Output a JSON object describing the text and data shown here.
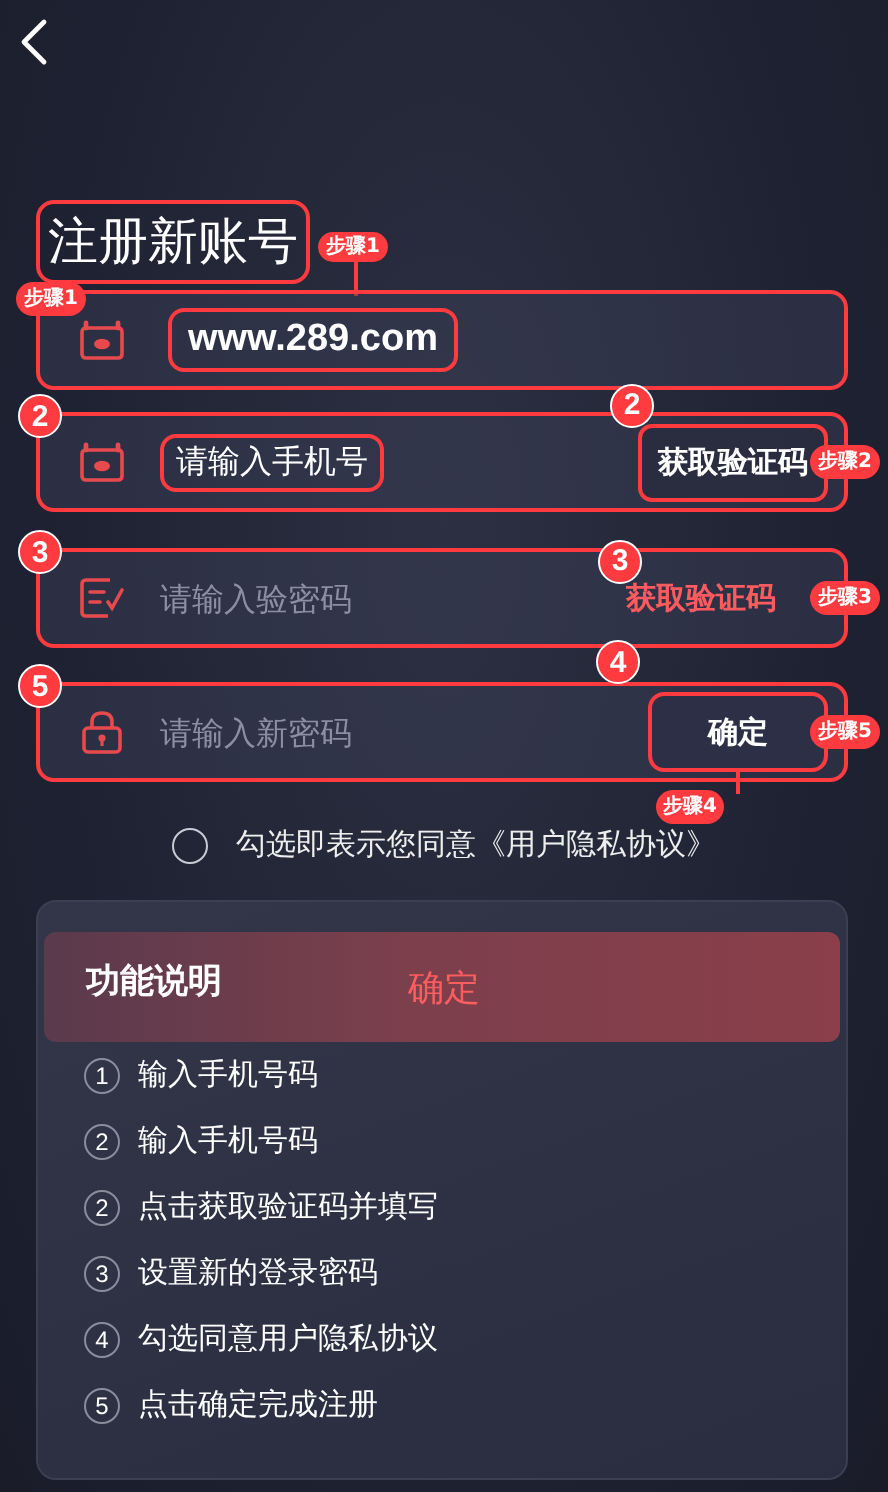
{
  "title": "注册新账号",
  "title_tag": "步骤1",
  "fields": [
    {
      "kind": "site",
      "value": "www.289.com",
      "corner_badge": {
        "kind": "pill",
        "text": "步骤1"
      }
    },
    {
      "kind": "phone",
      "value": "请输入手机号",
      "corner_badge": {
        "kind": "number",
        "text": "2"
      },
      "action": {
        "kind": "outlined",
        "text": "获取验证码",
        "badge": "2"
      },
      "side_badge": "步骤2"
    },
    {
      "kind": "code",
      "placeholder": "请输入验密码",
      "corner_badge": {
        "kind": "number",
        "text": "3"
      },
      "action": {
        "kind": "text",
        "text": "获取验证码",
        "badge": "3"
      },
      "side_badge": "步骤3"
    },
    {
      "kind": "password",
      "placeholder": "请输入新密码",
      "corner_badge": {
        "kind": "number",
        "text": "5"
      },
      "action": {
        "kind": "button",
        "text": "确定",
        "badge": "4",
        "below_badge": "步骤4"
      },
      "side_badge": "步骤5"
    }
  ],
  "agreement": {
    "checked": false,
    "text": "勾选即表示您同意《用户隐私协议》"
  },
  "guide": {
    "title": "功能说明",
    "overlay": "确定",
    "steps": [
      {
        "number": "1",
        "text": "输入手机号码"
      },
      {
        "number": "2",
        "text": "输入手机号码"
      },
      {
        "number": "2",
        "text": "点击获取验证码并填写"
      },
      {
        "number": "3",
        "text": "设置新的登录密码"
      },
      {
        "number": "4",
        "text": "勾选同意用户隐私协议"
      },
      {
        "number": "5",
        "text": "点击确定完成注册"
      }
    ]
  }
}
